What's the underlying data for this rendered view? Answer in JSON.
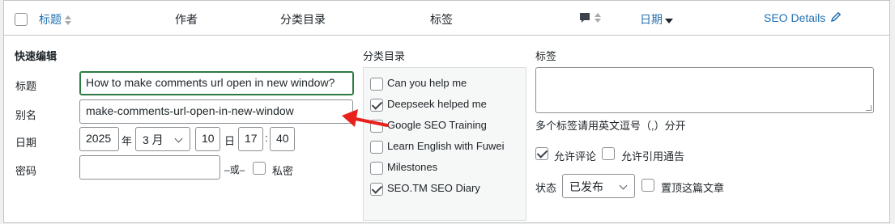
{
  "header": {
    "title_col": "标题",
    "author_col": "作者",
    "categories_col": "分类目录",
    "tags_col": "标签",
    "comments_icon": "comment-bubble-icon",
    "date_col": "日期",
    "seo_col": "SEO Details",
    "seo_icon": "pencil-icon"
  },
  "quick_edit": {
    "heading": "快速编辑",
    "title_label": "标题",
    "title_value": "How to make comments url open in new window?",
    "slug_label": "别名",
    "slug_value": "make-comments-url-open-in-new-window",
    "date_label": "日期",
    "year": "2025",
    "year_unit": "年",
    "month": "3 月",
    "day": "10",
    "day_unit": "日",
    "hour": "17",
    "time_sep": ":",
    "minute": "40",
    "password_label": "密码",
    "password_value": "",
    "or_text": "–或–",
    "private_label": "私密"
  },
  "categories": {
    "label": "分类目录",
    "items": [
      {
        "label": "Can you help me",
        "checked": false
      },
      {
        "label": "Deepseek helped me",
        "checked": true
      },
      {
        "label": "Google SEO Training",
        "checked": false
      },
      {
        "label": "Learn English with Fuwei",
        "checked": false
      },
      {
        "label": "Milestones",
        "checked": false
      },
      {
        "label": "SEO.TM SEO Diary",
        "checked": true
      }
    ]
  },
  "tags": {
    "label": "标签",
    "value": "",
    "hint": "多个标签请用英文逗号（,）分开"
  },
  "options": {
    "allow_comments": "允许评论",
    "allow_comments_checked": true,
    "allow_pings": "允许引用通告",
    "allow_pings_checked": false,
    "status_label": "状态",
    "status_value": "已发布",
    "sticky_label": "置顶这篇文章",
    "sticky_checked": false
  },
  "colors": {
    "link": "#2271b1",
    "annotation_arrow": "#e8211d",
    "focus_border": "#2c7a42"
  }
}
